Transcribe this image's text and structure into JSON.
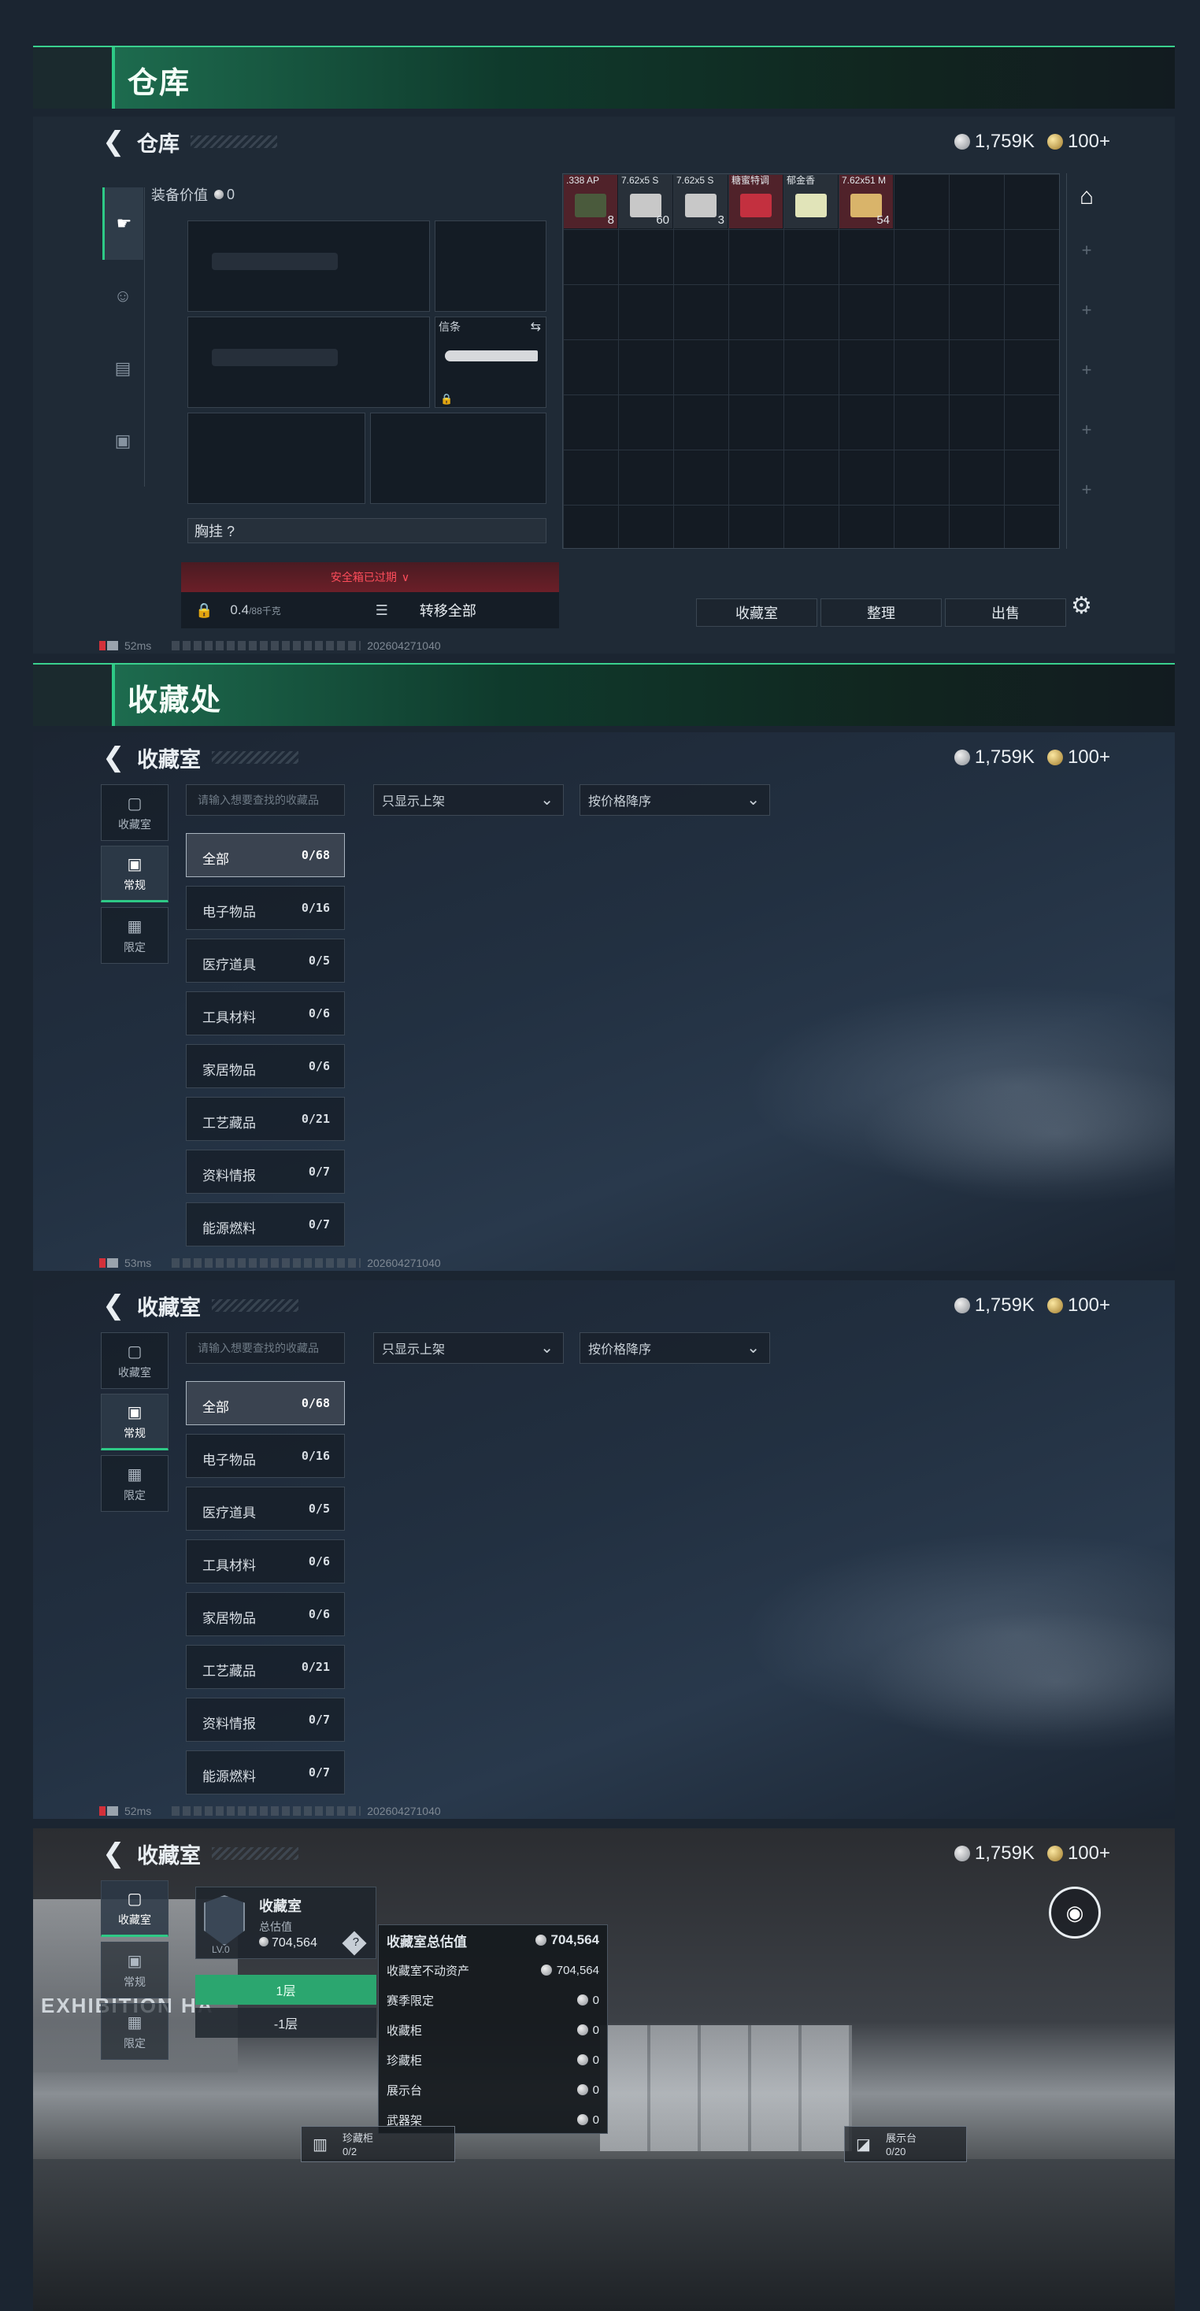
{
  "warehouse": {
    "header_title": "仓库",
    "page_title": "仓库",
    "currency": {
      "silver": "1,759K",
      "gold": "100+"
    },
    "equip_value_label": "装备价值",
    "equip_value": "0",
    "melee_label": "信条",
    "chest_label": "胸挂 ?",
    "safe_box_notice": "安全箱已过期",
    "weight": "0.4",
    "weight_max": "/88千克",
    "transfer_all": "转移全部",
    "items": [
      {
        "name": ".338 AP",
        "count": "8",
        "color": "#4a5a3c"
      },
      {
        "name": "7.62x5 S",
        "count": "60",
        "color": "#c8c8c8"
      },
      {
        "name": "7.62x5 S",
        "count": "3",
        "color": "#c8c8c8"
      },
      {
        "name": "糖蜜特调",
        "count": "",
        "color": "#c3303f"
      },
      {
        "name": "郁金香",
        "count": "",
        "color": "#e1e4b9"
      },
      {
        "name": "7.62x51 M",
        "count": "54",
        "color": "#d9b46a"
      }
    ],
    "buttons": {
      "collection": "收藏室",
      "sort": "整理",
      "sell": "出售"
    },
    "status": {
      "ping": "52ms",
      "code": "202604271040"
    }
  },
  "collection_header": {
    "title": "收藏处"
  },
  "collection_room": {
    "page_title": "收藏室",
    "currency": {
      "silver": "1,759K",
      "gold": "100+"
    },
    "tabs": [
      {
        "label": "收藏室",
        "icon": "collection-icon"
      },
      {
        "label": "常规",
        "icon": "regular-icon"
      },
      {
        "label": "限定",
        "icon": "limited-icon"
      }
    ],
    "search_placeholder": "请输入想要查找的收藏品",
    "filter_label": "只显示上架",
    "sort_label": "按价格降序",
    "categories": [
      {
        "name": "全部",
        "count": "0/68"
      },
      {
        "name": "电子物品",
        "count": "0/16"
      },
      {
        "name": "医疗道具",
        "count": "0/5"
      },
      {
        "name": "工具材料",
        "count": "0/6"
      },
      {
        "name": "家居物品",
        "count": "0/6"
      },
      {
        "name": "工艺藏品",
        "count": "0/21"
      },
      {
        "name": "资料情报",
        "count": "0/7"
      },
      {
        "name": "能源燃料",
        "count": "0/7"
      }
    ],
    "status1": {
      "ping": "53ms",
      "code": "202604271040"
    },
    "status2": {
      "ping": "52ms",
      "code": "202604271040"
    }
  },
  "hall": {
    "page_title": "收藏室",
    "currency": {
      "silver": "1,759K",
      "gold": "100+"
    },
    "tabs": [
      "收藏室",
      "常规",
      "限定"
    ],
    "card": {
      "name": "收藏室",
      "level": "LV.0",
      "value_label": "总估值",
      "value": "704,564",
      "help": "?"
    },
    "floors": [
      "1层",
      "-1层"
    ],
    "popup": [
      {
        "label": "收藏室总估值",
        "value": "704,564"
      },
      {
        "label": "收藏室不动资产",
        "value": "704,564"
      },
      {
        "label": "赛季限定",
        "value": "0"
      },
      {
        "label": "收藏柜",
        "value": "0"
      },
      {
        "label": "珍藏柜",
        "value": "0"
      },
      {
        "label": "展示台",
        "value": "0"
      },
      {
        "label": "武器架",
        "value": "0"
      }
    ],
    "tag_left": {
      "name": "珍藏柜",
      "count": "0/2"
    },
    "tag_right": {
      "name": "展示台",
      "count": "0/20"
    },
    "sign": "EXHIBITION HA"
  }
}
